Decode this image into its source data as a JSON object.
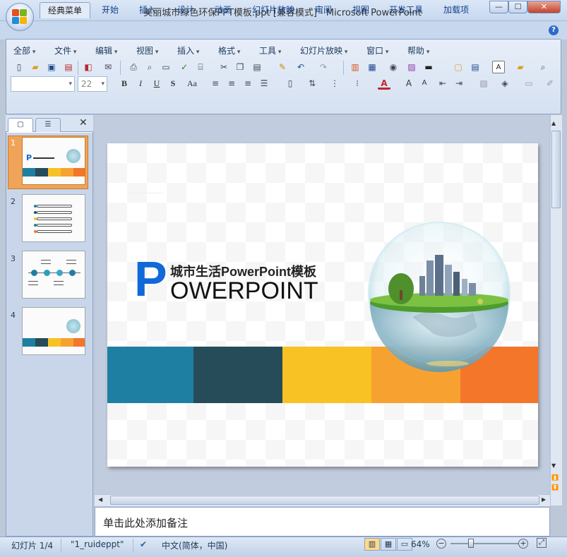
{
  "window": {
    "title": "美丽城市绿色环保PPT模板.ppt [兼容模式] - Microsoft PowerPoint",
    "buttons": {
      "minimize": "—",
      "maximize": "☐",
      "close": "✕"
    }
  },
  "quick_access": [
    {
      "icon": "save-icon",
      "glyph": "▣"
    },
    {
      "icon": "undo-icon",
      "glyph": "↶"
    },
    {
      "icon": "redo-icon",
      "glyph": "↻"
    },
    {
      "icon": "customize-qat-icon",
      "glyph": "▿"
    }
  ],
  "ribbon_tabs": [
    "经典菜单",
    "开始",
    "插入",
    "设计",
    "动画",
    "幻灯片放映",
    "审阅",
    "视图",
    "开发工具",
    "加载项"
  ],
  "active_tab": "经典菜单",
  "menus": [
    "全部",
    "文件",
    "编辑",
    "视图",
    "插入",
    "格式",
    "工具",
    "幻灯片放映",
    "窗口",
    "帮助"
  ],
  "font": {
    "name_value": "",
    "size_value": "22"
  },
  "format_buttons": {
    "bold": "B",
    "italic": "I",
    "underline": "U",
    "shadow": "S",
    "case": "Aa"
  },
  "slides_pane": {
    "tab_slides": "▢",
    "tab_outline": "☰",
    "close": "✕",
    "slides": [
      {
        "number": "1",
        "selected": true
      },
      {
        "number": "2",
        "selected": false
      },
      {
        "number": "3",
        "selected": false
      },
      {
        "number": "4",
        "selected": false
      }
    ]
  },
  "slide": {
    "big_letter": "P",
    "subtitle": "城市生活PowerPoint模板",
    "title": "OWERPOINT",
    "band_colors": [
      "#1e7fa3",
      "#264b59",
      "#f8c225",
      "#f7a230",
      "#f3762a"
    ]
  },
  "notes_placeholder": "单击此处添加备注",
  "status": {
    "slide_indicator": "幻灯片 1/4",
    "theme": "\"1_ruideppt\"",
    "language": "中文(简体，中国)",
    "zoom": "64%",
    "zoom_fraction": 0.64
  },
  "colors": {
    "accent_blue": "#1168d8",
    "ribbon_bg": "#d5e1f1"
  }
}
